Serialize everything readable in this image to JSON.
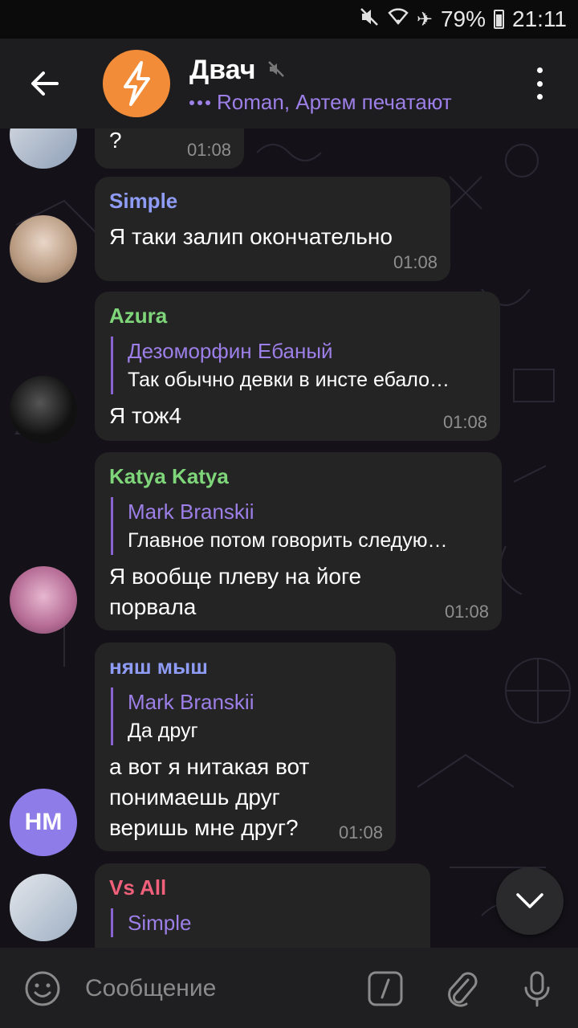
{
  "status_bar": {
    "battery": "79%",
    "time": "21:11"
  },
  "header": {
    "title": "Двач",
    "typing_names": "Roman, Артем печатают"
  },
  "messages": [
    {
      "text": "?",
      "time": "01:08"
    },
    {
      "sender": "Simple",
      "sender_color": "#8f9cf5",
      "text": "Я таки залип окончательно",
      "time": "01:08"
    },
    {
      "sender": "Azura",
      "sender_color": "#7fd67a",
      "reply_name": "Дезоморфин Ебаный",
      "reply_text": "Так обычно девки в инсте ебало…",
      "text": "Я тож4",
      "time": "01:08"
    },
    {
      "sender": "Katya Katya",
      "sender_color": "#7fd67a",
      "reply_name": "Mark Branskii",
      "reply_text": "Главное потом говорить следую…",
      "text": "Я вообще плеву на йоге порвала",
      "time": "01:08"
    },
    {
      "sender": "няш мыш",
      "sender_color": "#8f9cf5",
      "avatar_initials": "НМ",
      "reply_name": "Mark Branskii",
      "reply_text": "Да друг",
      "text": "а вот я нитакая вот понимаешь друг веришь мне друг?",
      "time": "01:08"
    },
    {
      "sender": "Vs All",
      "sender_color": "#f0607a",
      "reply_name": "Simple"
    }
  ],
  "input": {
    "placeholder": "Сообщение"
  },
  "colors": {
    "accent": "#9d7fe8",
    "bubble": "#242424",
    "avatar_orange": "#f28c38",
    "avatar_purple": "#8e7ce8"
  }
}
